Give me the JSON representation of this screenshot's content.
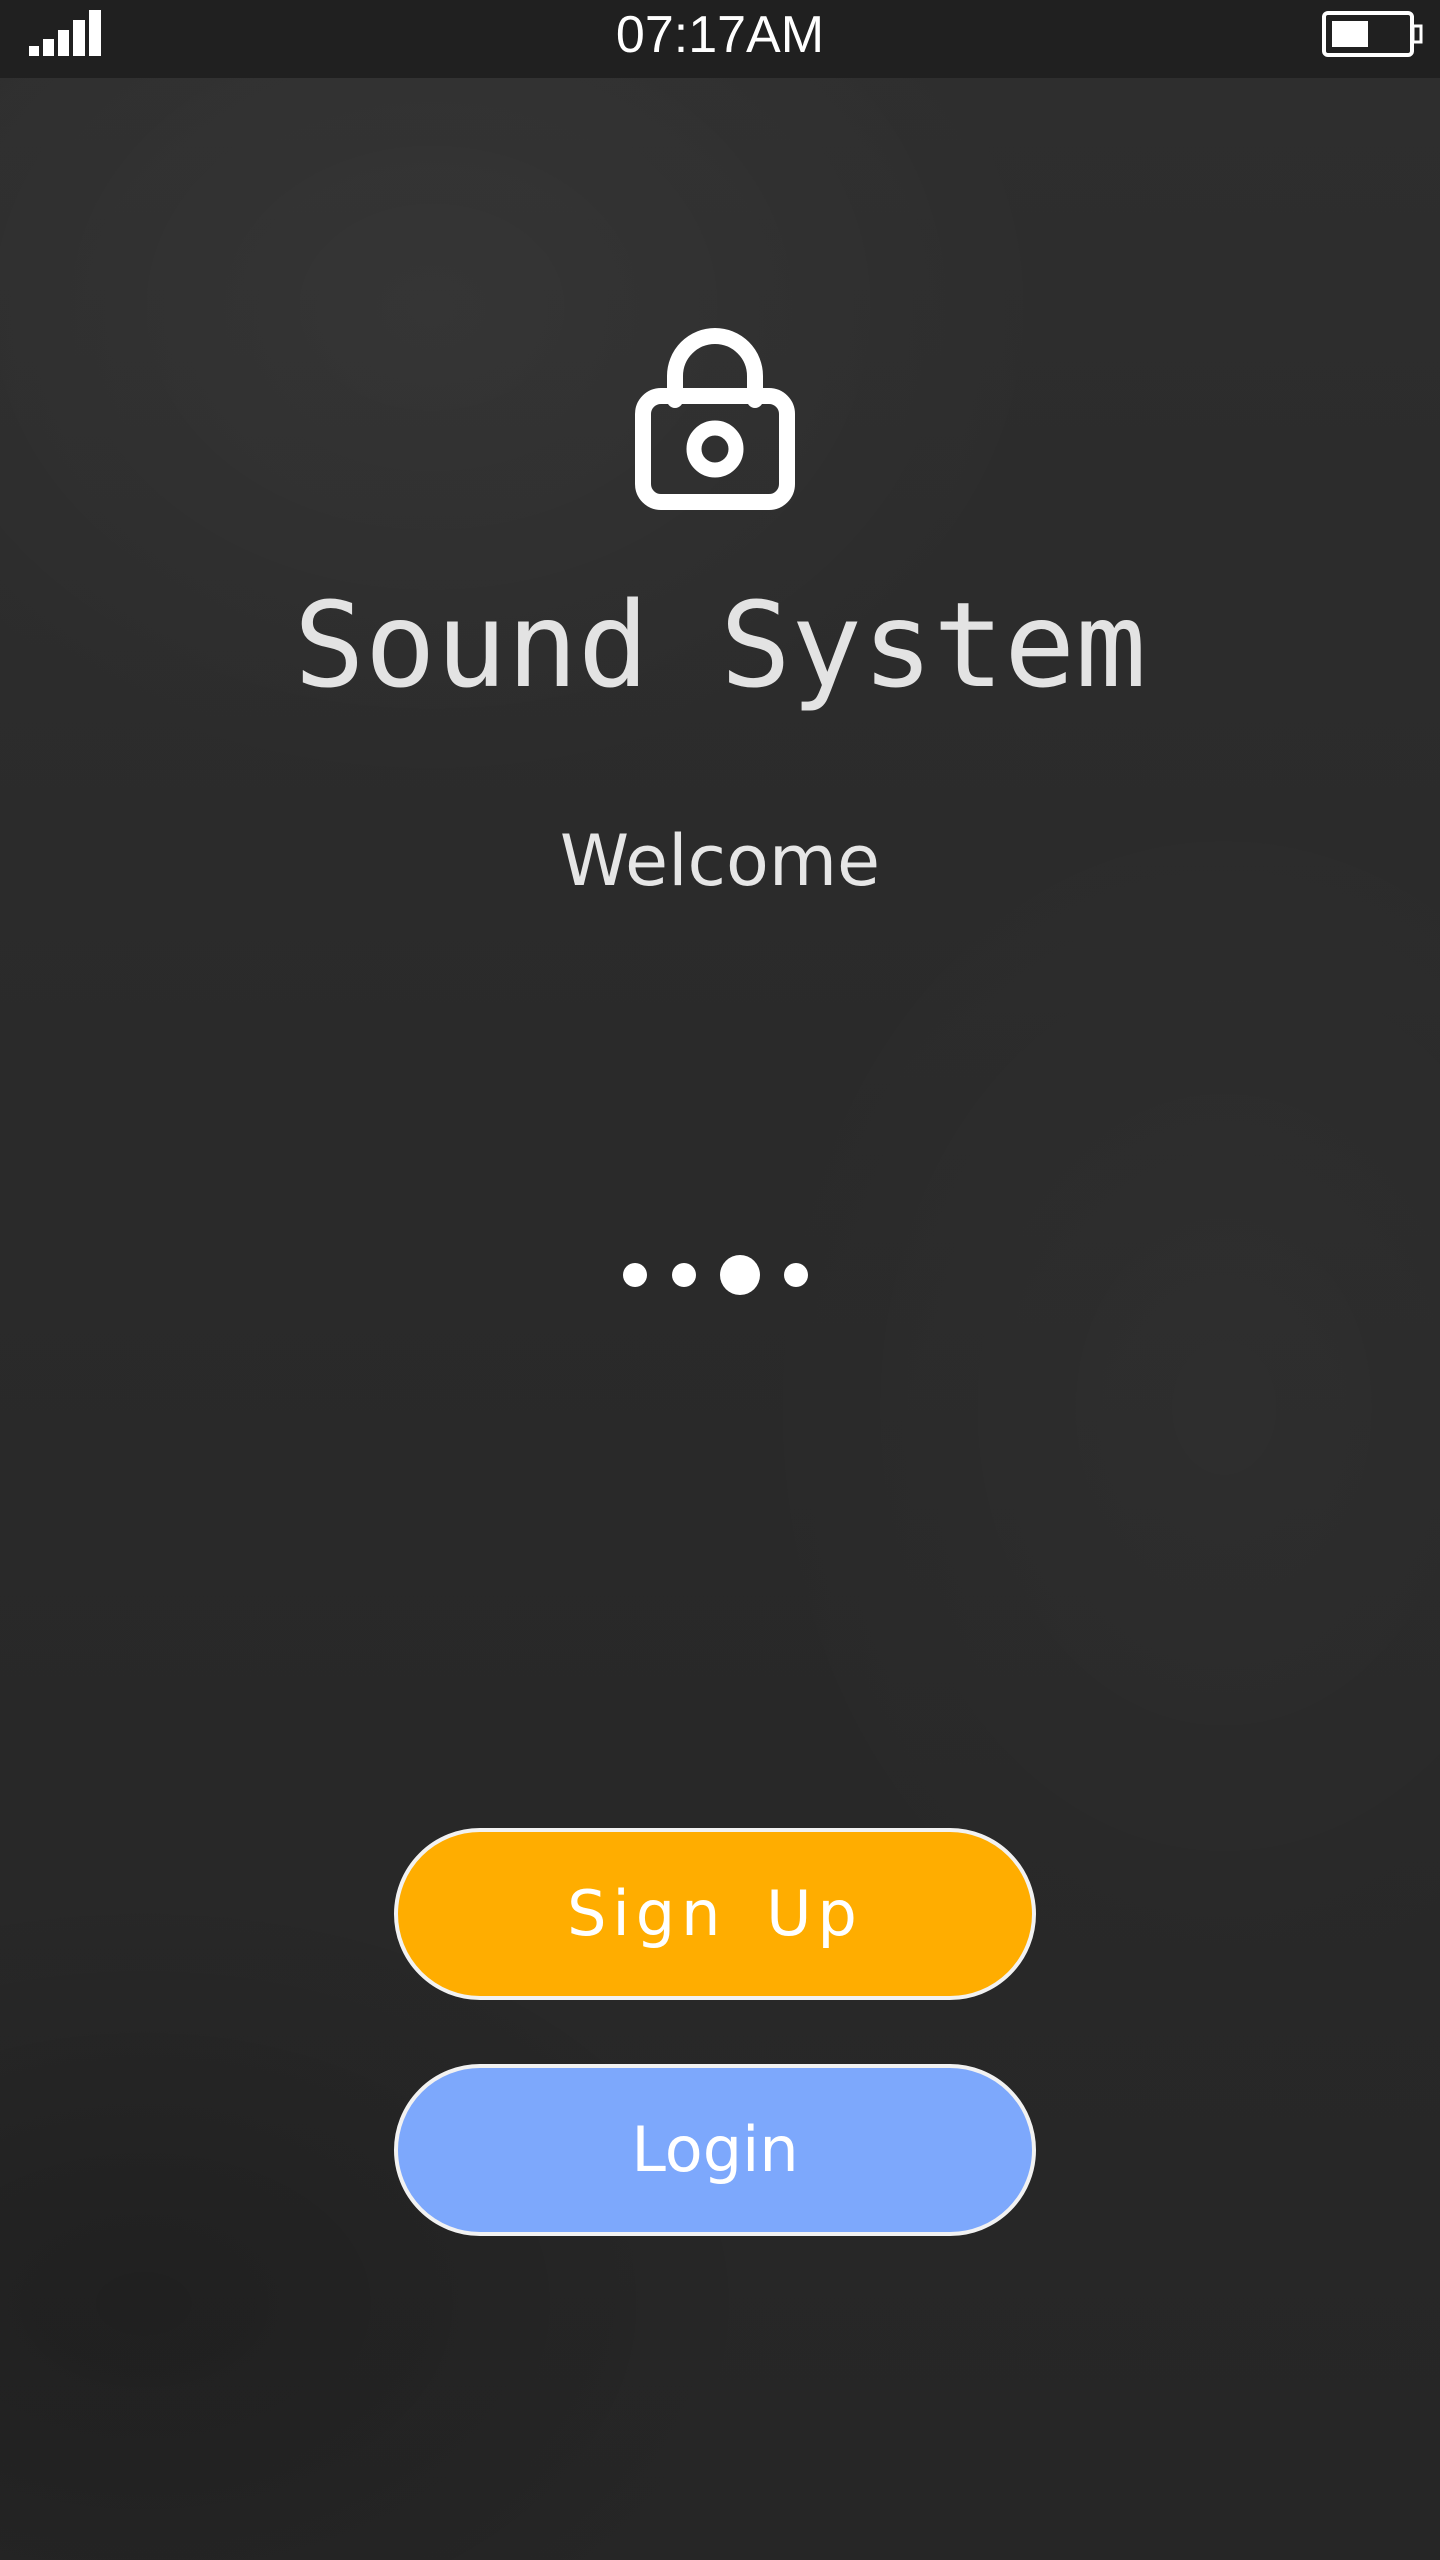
{
  "status_bar": {
    "time": "07:17AM",
    "signal_icon": "signal-bars-icon",
    "battery_icon": "battery-icon",
    "battery_level": 0.5
  },
  "hero": {
    "icon": "lock-icon",
    "title": "Sound System",
    "subtitle": "Welcome"
  },
  "pager": {
    "count": 4,
    "active_index": 2
  },
  "actions": {
    "signup_label": "Sign Up",
    "login_label": "Login"
  },
  "colors": {
    "background": "#2b2b2b",
    "signup": "#ffad00",
    "login": "#7da8fc",
    "text": "#e3e3e3"
  }
}
